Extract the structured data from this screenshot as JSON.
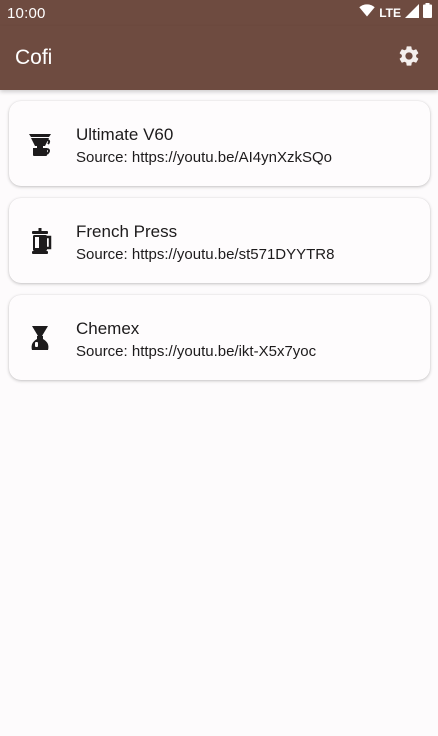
{
  "status_bar": {
    "time": "10:00",
    "network": "LTE",
    "icons": [
      "wifi-icon",
      "signal-icon",
      "battery-icon"
    ]
  },
  "app_bar": {
    "title": "Cofi",
    "settings_icon": "gear-icon",
    "background_color": "#6e4b40"
  },
  "recipes": [
    {
      "title": "Ultimate V60",
      "source": "Source: https://youtu.be/AI4ynXzkSQo",
      "icon": "v60-dripper-icon"
    },
    {
      "title": "French Press",
      "source": "Source: https://youtu.be/st571DYYTR8",
      "icon": "french-press-icon"
    },
    {
      "title": "Chemex",
      "source": "Source: https://youtu.be/ikt-X5x7yoc",
      "icon": "chemex-icon"
    }
  ]
}
